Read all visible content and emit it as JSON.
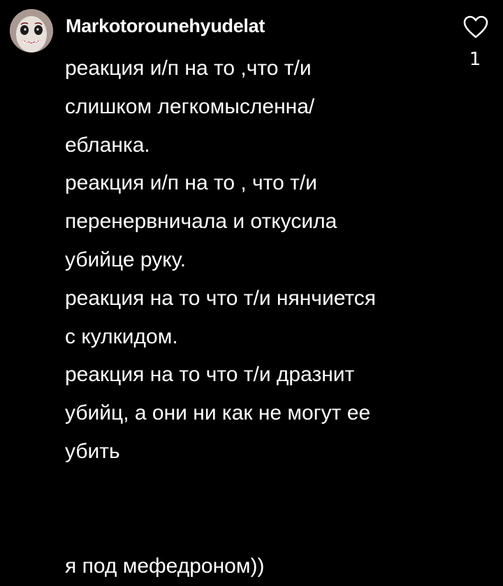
{
  "comment": {
    "username": "Markotorounehyudelat",
    "avatar_icon": "avatar-mask-face",
    "lines_part1": [
      "реакция и/п на то ,что т/и",
      "слишком легкомысленна/",
      "ебланка.",
      "реакция и/п на то , что т/и",
      "перенервничала и откусила",
      "убийце руку.",
      "реакция на то что т/и нянчиется",
      "с кулкидом.",
      "реакция на то что т/и дразнит",
      "убийц, а они ни как не могут ее",
      "убить"
    ],
    "lines_part2": [
      "я под мефедроном))"
    ],
    "like_icon": "heart-outline-icon",
    "like_count": "1"
  },
  "colors": {
    "background": "#000000",
    "text": "#ffffff"
  }
}
